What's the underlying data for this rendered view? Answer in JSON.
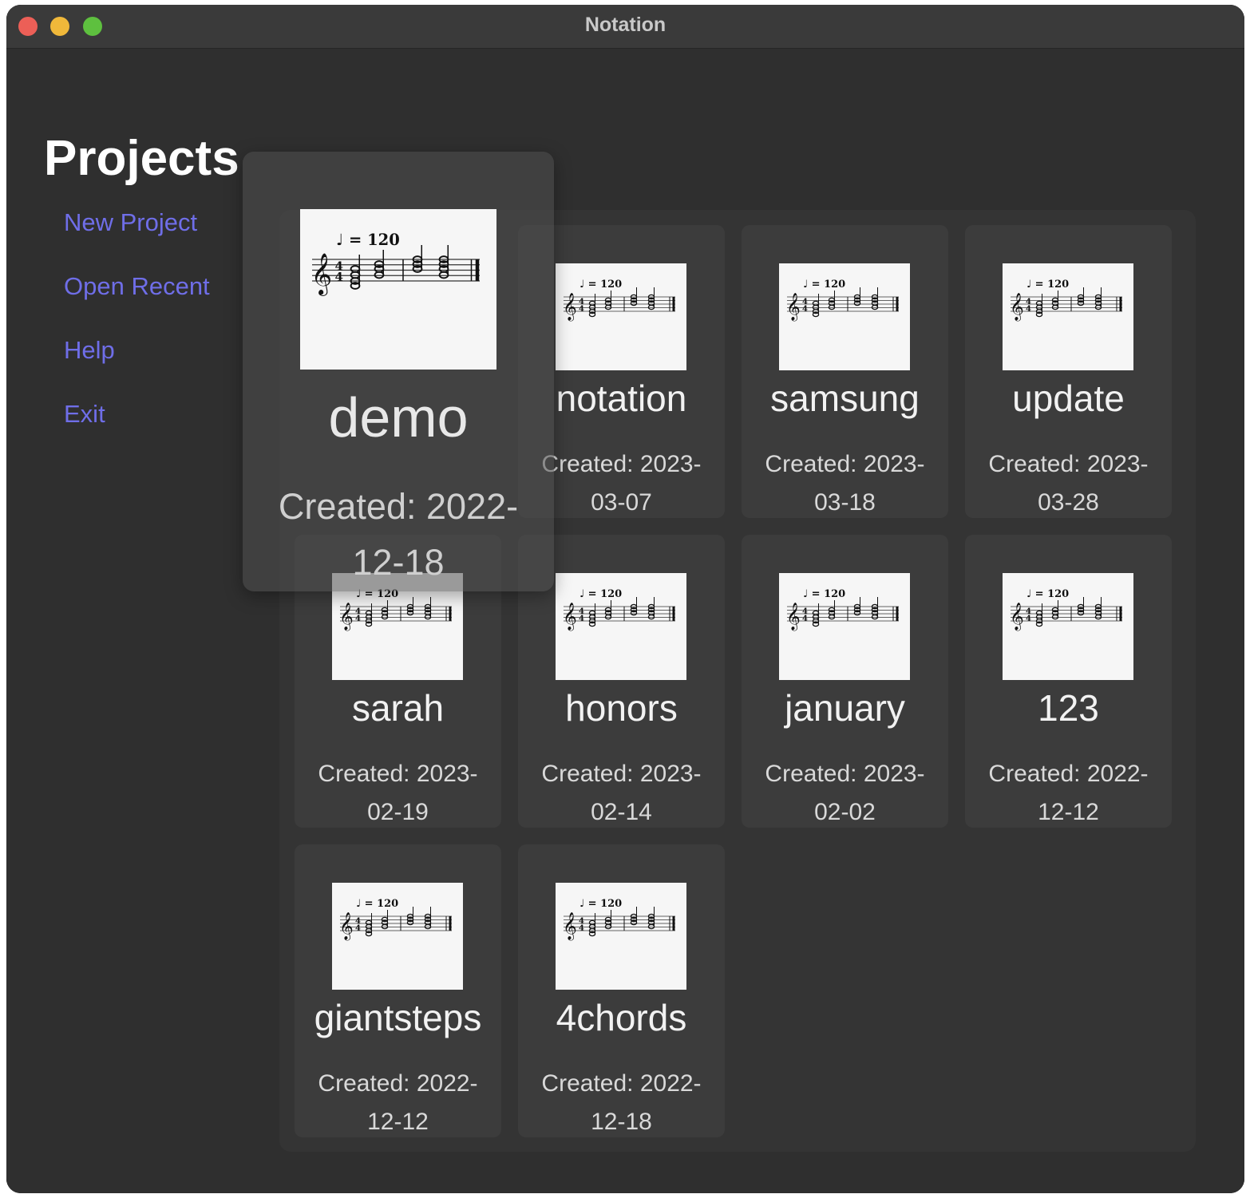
{
  "window": {
    "title": "Notation"
  },
  "sidebar": {
    "heading": "Projects",
    "items": [
      {
        "label": "New Project"
      },
      {
        "label": "Open Recent"
      },
      {
        "label": "Help"
      },
      {
        "label": "Exit"
      }
    ]
  },
  "thumbnail": {
    "tempo_text": "♩ = 120"
  },
  "projects": [
    {
      "name": "demo",
      "created_line1": "Created: 2022-",
      "created_line2": "12-18",
      "state": "hovered"
    },
    {
      "name": "notation",
      "created_line1": "Created: 2023-",
      "created_line2": "03-07"
    },
    {
      "name": "samsung",
      "created_line1": "Created: 2023-",
      "created_line2": "03-18"
    },
    {
      "name": "update",
      "created_line1": "Created: 2023-",
      "created_line2": "03-28"
    },
    {
      "name": "sarah",
      "created_line1": "Created: 2023-",
      "created_line2": "02-19"
    },
    {
      "name": "honors",
      "created_line1": "Created: 2023-",
      "created_line2": "02-14"
    },
    {
      "name": "january",
      "created_line1": "Created: 2023-",
      "created_line2": "02-02"
    },
    {
      "name": "123",
      "created_line1": "Created: 2022-",
      "created_line2": "12-12"
    },
    {
      "name": "giantsteps",
      "created_line1": "Created: 2022-",
      "created_line2": "12-12"
    },
    {
      "name": "4chords",
      "created_line1": "Created: 2022-",
      "created_line2": "12-18"
    }
  ],
  "colors": {
    "background": "#2f2f2f",
    "accent_link": "#6f6ee8",
    "card": "#3c3c3c"
  }
}
